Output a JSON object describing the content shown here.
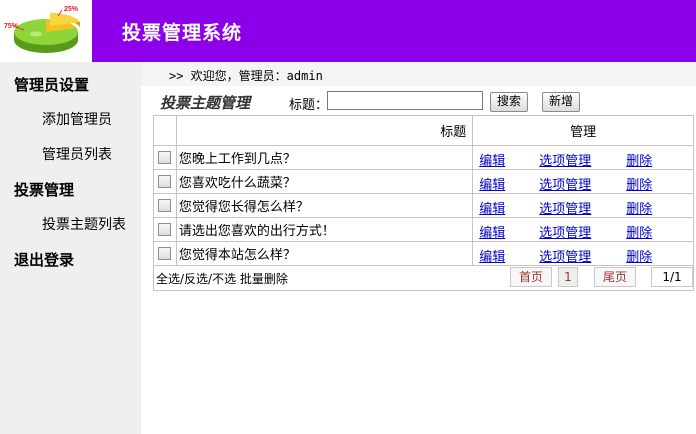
{
  "header": {
    "title": "投票管理系统",
    "logo_labels": {
      "left": "75%",
      "right": "25%"
    },
    "bar_color": "#8b00e8"
  },
  "sidebar": {
    "sections": [
      {
        "label": "管理员设置",
        "items": [
          {
            "label": "添加管理员"
          },
          {
            "label": "管理员列表"
          }
        ]
      },
      {
        "label": "投票管理",
        "items": [
          {
            "label": "投票主题列表"
          }
        ]
      },
      {
        "label": "退出登录",
        "items": []
      }
    ]
  },
  "welcome": {
    "text": ">> 欢迎您，管理员：admin"
  },
  "toolbar": {
    "section_title": "投票主题管理",
    "search_label": "标题：",
    "search_value": "",
    "search_button": "搜索",
    "add_button": "新增"
  },
  "table": {
    "headers": {
      "title": "标题",
      "manage": "管理"
    },
    "rows": [
      {
        "title": "您晚上工作到几点？",
        "edit": "编辑",
        "options": "选项管理",
        "delete": "删除"
      },
      {
        "title": "您喜欢吃什么蔬菜？",
        "edit": "编辑",
        "options": "选项管理",
        "delete": "删除"
      },
      {
        "title": "您觉得您长得怎么样？",
        "edit": "编辑",
        "options": "选项管理",
        "delete": "删除"
      },
      {
        "title": "请选出您喜欢的出行方式！",
        "edit": "编辑",
        "options": "选项管理",
        "delete": "删除"
      },
      {
        "title": "您觉得本站怎么样？",
        "edit": "编辑",
        "options": "选项管理",
        "delete": "删除"
      }
    ]
  },
  "footer": {
    "bulk_actions": "全选/反选/不选  批量删除",
    "first_page": "首页",
    "current_page": "1",
    "last_page": "尾页",
    "page_count": "1/1"
  },
  "colors": {
    "link": "#0000cc",
    "pager_text": "#993333"
  }
}
